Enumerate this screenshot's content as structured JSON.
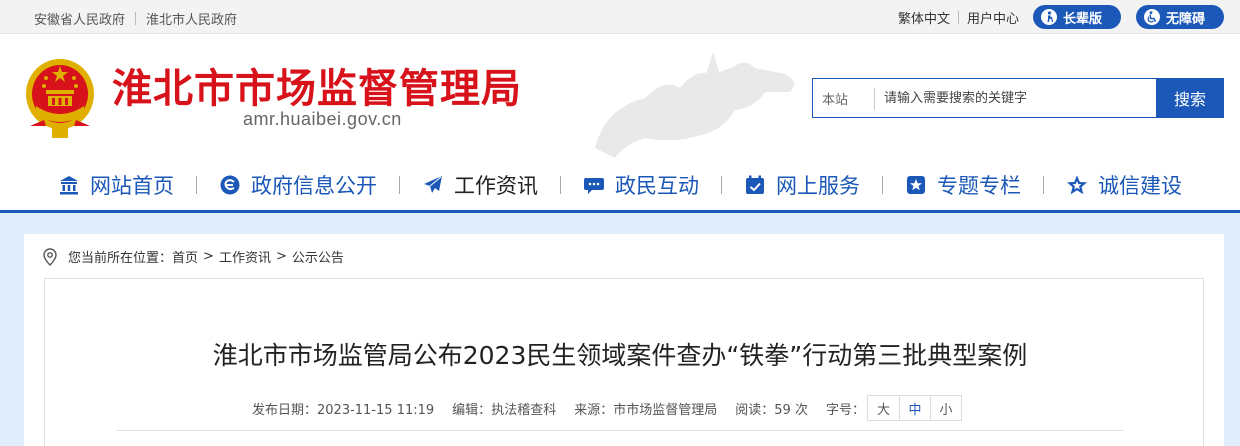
{
  "topbar": {
    "left_links": [
      "安徽省人民政府",
      "淮北市人民政府"
    ],
    "right_links": [
      "繁体中文",
      "用户中心"
    ],
    "elder_mode": "长辈版",
    "accessible_mode": "无障碍"
  },
  "header": {
    "title": "淮北市市场监督管理局",
    "domain": "amr.huaibei.gov.cn"
  },
  "search": {
    "scope": "本站",
    "placeholder": "请输入需要搜索的关键字",
    "button": "搜索"
  },
  "nav": {
    "items": [
      {
        "label": "网站首页",
        "icon": "bank-icon"
      },
      {
        "label": "政府信息公开",
        "icon": "info-disclosure-icon"
      },
      {
        "label": "工作资讯",
        "icon": "paper-plane-icon"
      },
      {
        "label": "政民互动",
        "icon": "chat-icon"
      },
      {
        "label": "网上服务",
        "icon": "calendar-check-icon"
      },
      {
        "label": "专题专栏",
        "icon": "star-badge-icon"
      },
      {
        "label": "诚信建设",
        "icon": "star-icon"
      }
    ],
    "active_index": 2
  },
  "breadcrumb": {
    "prefix": "您当前所在位置：",
    "items": [
      "首页",
      "工作资讯",
      "公示公告"
    ],
    "separator": ">"
  },
  "article": {
    "title": "淮北市市场监管局公布2023民生领域案件查办“铁拳”行动第三批典型案例",
    "publish_label": "发布日期：",
    "publish_date": "2023-11-15 11:19",
    "editor_label": "编辑：",
    "editor": "执法稽查科",
    "source_label": "来源：",
    "source": "市市场监督管理局",
    "views_label": "阅读：",
    "views": "59",
    "views_unit": "次",
    "font_size_label": "字号：",
    "font_sizes": [
      "大",
      "中",
      "小"
    ],
    "font_size_selected": "中"
  },
  "colors": {
    "brand_blue": "#1b58b8",
    "title_red": "#d7121a",
    "content_bg": "#dfecf9"
  }
}
